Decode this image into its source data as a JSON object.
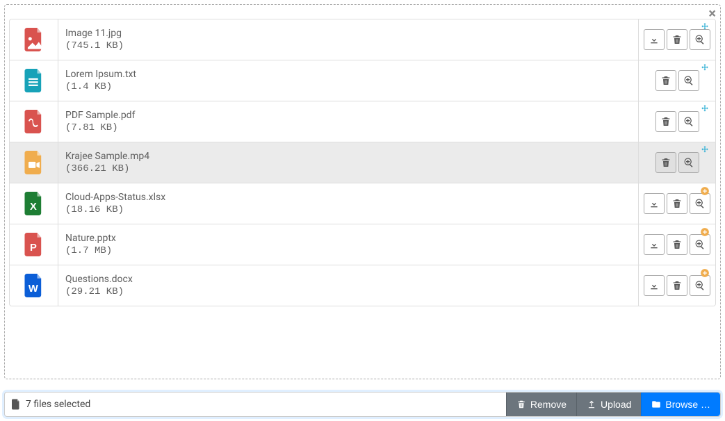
{
  "footer": {
    "caption": "7 files selected",
    "remove_label": "Remove",
    "upload_label": "Upload",
    "browse_label": "Browse …"
  },
  "files": [
    {
      "name": "Image 11.jpg",
      "size": "(745.1 KB)",
      "icon": "image",
      "icon_color": "#d9534f",
      "actions": [
        "download",
        "delete",
        "zoom"
      ],
      "status": "move",
      "highlight": false
    },
    {
      "name": "Lorem Ipsum.txt",
      "size": "(1.4 KB)",
      "icon": "text",
      "icon_color": "#17a2b8",
      "actions": [
        "delete",
        "zoom"
      ],
      "status": "move",
      "highlight": false
    },
    {
      "name": "PDF Sample.pdf",
      "size": "(7.81 KB)",
      "icon": "pdf",
      "icon_color": "#d9534f",
      "actions": [
        "delete",
        "zoom"
      ],
      "status": "move",
      "highlight": false
    },
    {
      "name": "Krajee Sample.mp4",
      "size": "(366.21 KB)",
      "icon": "video",
      "icon_color": "#f0ad4e",
      "actions": [
        "delete",
        "zoom"
      ],
      "status": "move",
      "highlight": true
    },
    {
      "name": "Cloud-Apps-Status.xlsx",
      "size": "(18.16 KB)",
      "icon": "excel",
      "icon_color": "#1e7e34",
      "actions": [
        "download",
        "delete",
        "zoom"
      ],
      "status": "new",
      "highlight": false
    },
    {
      "name": "Nature.pptx",
      "size": "(1.7 MB)",
      "icon": "ppt",
      "icon_color": "#d9534f",
      "actions": [
        "download",
        "delete",
        "zoom"
      ],
      "status": "new",
      "highlight": false
    },
    {
      "name": "Questions.docx",
      "size": "(29.21 KB)",
      "icon": "word",
      "icon_color": "#0b5ed7",
      "actions": [
        "download",
        "delete",
        "zoom"
      ],
      "status": "new",
      "highlight": false
    }
  ],
  "icons": {
    "download": "download-icon",
    "delete": "trash-icon",
    "zoom": "zoom-in-icon",
    "move": "move-icon",
    "new": "plus-circle-icon"
  },
  "colors": {
    "accent_blue": "#007bff",
    "status_move": "#31b0d5",
    "status_new": "#f0ad4e",
    "btn_gray": "#6c757d"
  }
}
